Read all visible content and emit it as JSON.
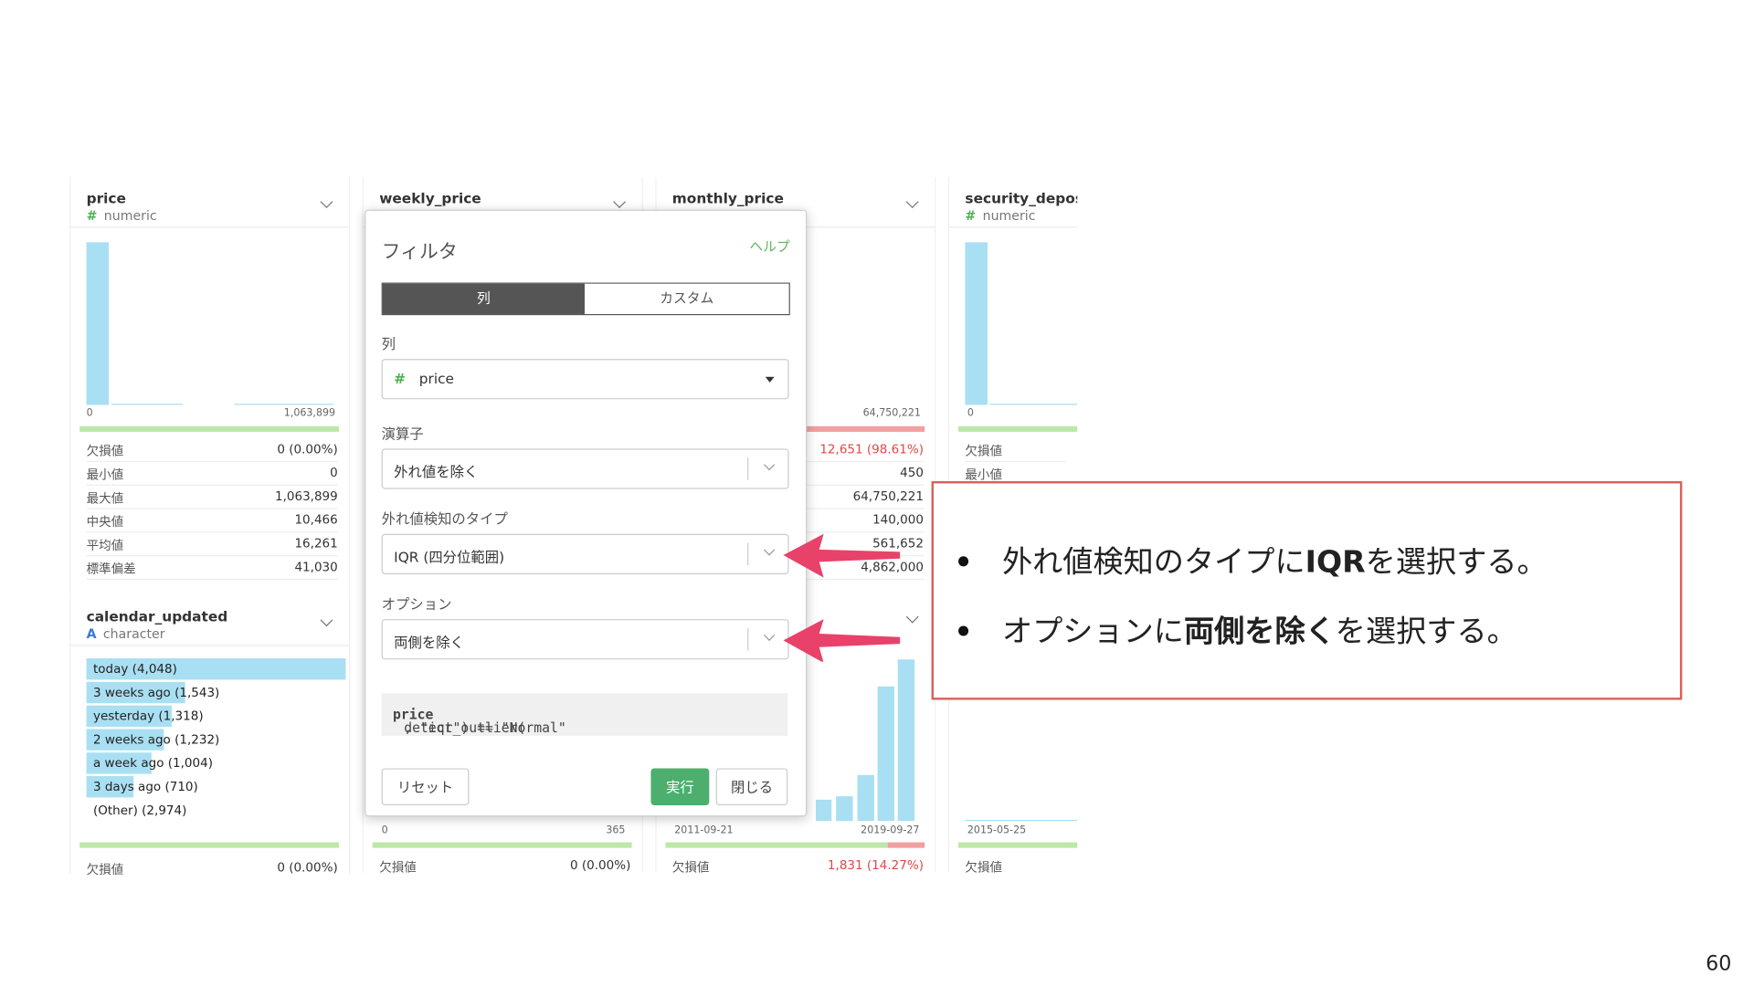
{
  "cards": {
    "price": {
      "title": "price",
      "type": "numeric",
      "axis_min": "0",
      "axis_max": "1,063,899",
      "stats": [
        {
          "k": "欠損値",
          "v": "0 (0.00%)"
        },
        {
          "k": "最小値",
          "v": "0"
        },
        {
          "k": "最大値",
          "v": "1,063,899"
        },
        {
          "k": "中央値",
          "v": "10,466"
        },
        {
          "k": "平均値",
          "v": "16,261"
        },
        {
          "k": "標準偏差",
          "v": "41,030"
        }
      ]
    },
    "weekly_price": {
      "title": "weekly_price",
      "axis_min": "0",
      "axis_max": "365",
      "missing_label": "欠損値",
      "missing_value": "0 (0.00%)"
    },
    "monthly_price": {
      "title": "monthly_price",
      "axis_max": "64,750,221",
      "stats": [
        {
          "k": "",
          "v": "12,651 (98.61%)"
        },
        {
          "k": "",
          "v": "450"
        },
        {
          "k": "",
          "v": "64,750,221"
        },
        {
          "k": "",
          "v": "140,000"
        },
        {
          "k": "",
          "v": "561,652"
        },
        {
          "k": "",
          "v": "4,862,000"
        }
      ],
      "axis2_min": "2011-09-21",
      "axis2_max": "2019-09-27",
      "missing_label": "欠損値",
      "missing_value": "1,831 (14.27%)"
    },
    "security_deposit": {
      "title": "security_deposi",
      "type": "numeric",
      "axis_min": "0",
      "stats": [
        {
          "k": "欠損値"
        },
        {
          "k": "最小値"
        }
      ],
      "axis2_min": "2015-05-25",
      "missing_label": "欠損値"
    },
    "calendar_updated": {
      "title": "calendar_updated",
      "type": "character",
      "categories": [
        {
          "label": "today (4,048)",
          "fraction": 1.0
        },
        {
          "label": "3 weeks ago (1,543)",
          "fraction": 0.38
        },
        {
          "label": "yesterday (1,318)",
          "fraction": 0.33
        },
        {
          "label": "2 weeks ago (1,232)",
          "fraction": 0.3
        },
        {
          "label": "a week ago (1,004)",
          "fraction": 0.25
        },
        {
          "label": "3 days ago (710)",
          "fraction": 0.18
        },
        {
          "label": "(Other) (2,974)",
          "fraction": 0
        }
      ],
      "missing_label": "欠損値",
      "missing_value": "0 (0.00%)"
    }
  },
  "dialog": {
    "title": "フィルタ",
    "help": "ヘルプ",
    "tab_column": "列",
    "tab_custom": "カスタム",
    "column_label": "列",
    "column_value": "price",
    "operator_label": "演算子",
    "operator_value": "外れ値を除く",
    "detect_type_label": "外れ値検知のタイプ",
    "detect_type_value": "IQR (四分位範囲)",
    "option_label": "オプション",
    "option_value": "両側を除く",
    "code_prefix": "detect_outlier(",
    "code_bold": "price",
    "code_suffix": ", \"iqr\") == \"Normal\"",
    "reset_button": "リセット",
    "run_button": "実行",
    "close_button": "閉じる"
  },
  "callout": {
    "bullet1_a": "外れ値検知のタイプに",
    "bullet1_b": "IQR",
    "bullet1_c": "を選択する。",
    "bullet2_a": "オプションに",
    "bullet2_b": "両側を除く",
    "bullet2_c": "を選択する。"
  },
  "page_number": "60",
  "colors": {
    "accent_green": "#4caf6e",
    "callout_border": "#d9625c",
    "arrow": "#e8426a",
    "bar": "#a9dff2"
  }
}
